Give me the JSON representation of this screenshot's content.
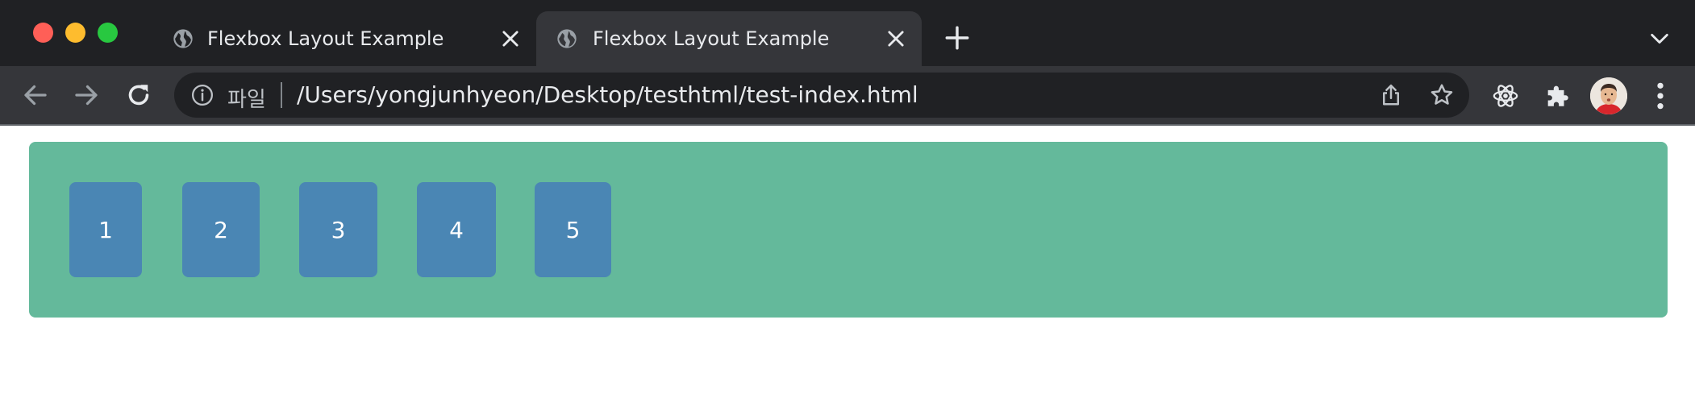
{
  "browser": {
    "tabs": [
      {
        "title": "Flexbox Layout Example",
        "active": false
      },
      {
        "title": "Flexbox Layout Example",
        "active": true
      }
    ],
    "omnibox": {
      "scheme_label": "파일",
      "url": "/Users/yongjunhyeon/Desktop/testhtml/test-index.html"
    },
    "colors": {
      "tabstrip": "#202124",
      "toolbar": "#35363a",
      "omnibox": "#202124"
    }
  },
  "page": {
    "container_color": "#64b99b",
    "box_color": "#4a86b4",
    "boxes": [
      "1",
      "2",
      "3",
      "4",
      "5"
    ]
  }
}
